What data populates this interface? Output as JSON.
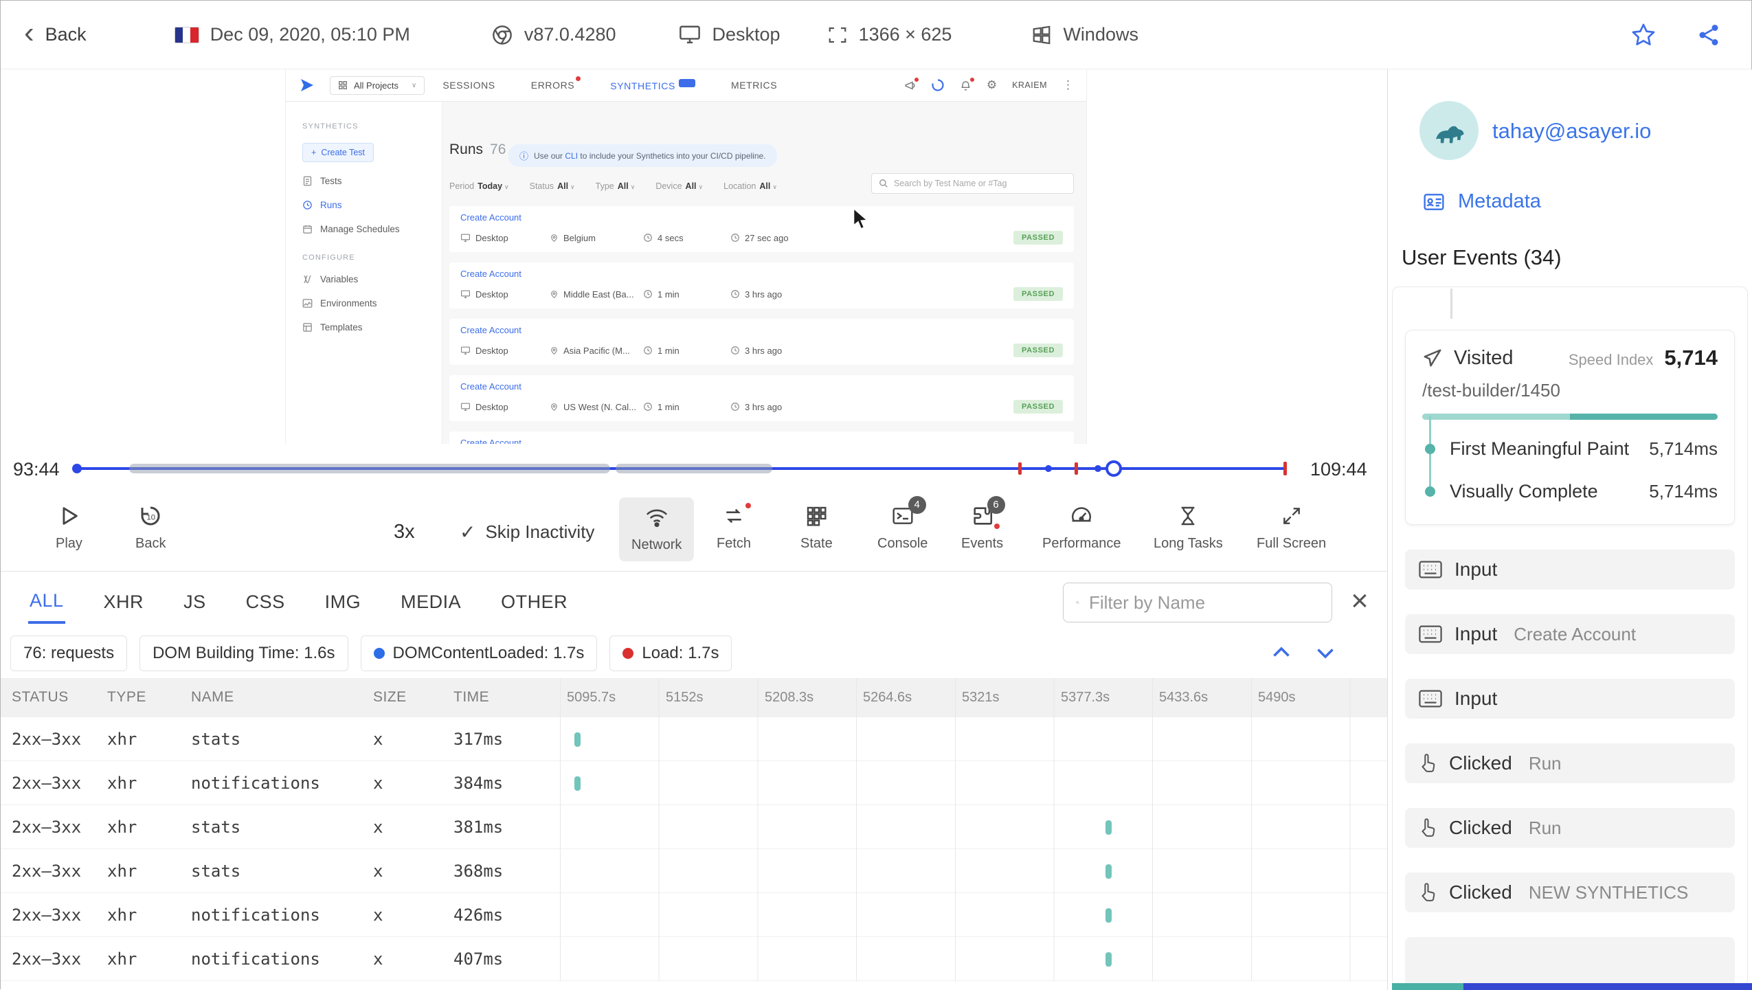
{
  "glyphs": {
    "back_chevron": "‹",
    "check": "✓",
    "close": "×",
    "caret": "∨",
    "kebab": "⋮",
    "info": "ⓘ",
    "fetch": "⇄",
    "gear": "⚙",
    "plus": "+"
  },
  "topbar": {
    "back_label": "Back",
    "datetime": "Dec 09, 2020, 05:10 PM",
    "browser_version": "v87.0.4280",
    "device": "Desktop",
    "resolution": "1366 × 625",
    "os": "Windows"
  },
  "app": {
    "nav": {
      "project": "All Projects",
      "tabs": [
        "SESSIONS",
        "ERRORS",
        "SYNTHETICS",
        "METRICS"
      ],
      "user": "KRAIEM"
    },
    "sidebar": {
      "section_synthetics": "SYNTHETICS",
      "create_test": "Create Test",
      "tests": "Tests",
      "runs": "Runs",
      "manage_schedules": "Manage Schedules",
      "section_configure": "CONFIGURE",
      "variables": "Variables",
      "environments": "Environments",
      "templates": "Templates"
    },
    "main": {
      "title": "Runs",
      "count": "76",
      "banner": {
        "pre": "Use our ",
        "link": "CLI",
        "post": " to include your Synthetics into your CI/CD pipeline."
      },
      "filters": [
        {
          "label": "Period",
          "value": "Today"
        },
        {
          "label": "Status",
          "value": "All"
        },
        {
          "label": "Type",
          "value": "All"
        },
        {
          "label": "Device",
          "value": "All"
        },
        {
          "label": "Location",
          "value": "All"
        }
      ],
      "search_placeholder": "Search by Test Name or #Tag",
      "runs": [
        {
          "name": "Create Account",
          "device": "Desktop",
          "location": "Belgium",
          "duration": "4 secs",
          "ago": "27 sec ago",
          "status": "PASSED"
        },
        {
          "name": "Create Account",
          "device": "Desktop",
          "location": "Middle East (Ba...",
          "duration": "1 min",
          "ago": "3 hrs ago",
          "status": "PASSED"
        },
        {
          "name": "Create Account",
          "device": "Desktop",
          "location": "Asia Pacific (M...",
          "duration": "1 min",
          "ago": "3 hrs ago",
          "status": "PASSED"
        },
        {
          "name": "Create Account",
          "device": "Desktop",
          "location": "US West (N. Cal...",
          "duration": "1 min",
          "ago": "3 hrs ago",
          "status": "PASSED"
        },
        {
          "name": "Create Account"
        }
      ]
    }
  },
  "timeline": {
    "start": "93:44",
    "end": "109:44"
  },
  "controls": {
    "play": "Play",
    "back": "Back",
    "back_amount": "10",
    "speed": "3x",
    "skip_inactivity": "Skip Inactivity",
    "network": "Network",
    "fetch": "Fetch",
    "state": "State",
    "console": "Console",
    "console_badge": "4",
    "events": "Events",
    "events_badge": "6",
    "performance": "Performance",
    "long_tasks": "Long Tasks",
    "full_screen": "Full Screen"
  },
  "network": {
    "tabs": [
      "ALL",
      "XHR",
      "JS",
      "CSS",
      "IMG",
      "MEDIA",
      "OTHER"
    ],
    "filter_placeholder": "Filter by Name",
    "summary": {
      "requests": "76: requests",
      "dom_building": "DOM Building Time: 1.6s",
      "dom_content_loaded": "DOMContentLoaded: 1.7s",
      "load": "Load: 1.7s"
    },
    "columns": [
      "STATUS",
      "TYPE",
      "NAME",
      "SIZE",
      "TIME"
    ],
    "time_ticks": [
      "5095.7s",
      "5152s",
      "5208.3s",
      "5264.6s",
      "5321s",
      "5377.3s",
      "5433.6s",
      "5490s"
    ],
    "rows": [
      {
        "status": "2xx–3xx",
        "type": "xhr",
        "name": "stats",
        "size": "x",
        "time": "317ms"
      },
      {
        "status": "2xx–3xx",
        "type": "xhr",
        "name": "notifications",
        "size": "x",
        "time": "384ms"
      },
      {
        "status": "2xx–3xx",
        "type": "xhr",
        "name": "stats",
        "size": "x",
        "time": "381ms"
      },
      {
        "status": "2xx–3xx",
        "type": "xhr",
        "name": "stats",
        "size": "x",
        "time": "368ms"
      },
      {
        "status": "2xx–3xx",
        "type": "xhr",
        "name": "notifications",
        "size": "x",
        "time": "426ms"
      },
      {
        "status": "2xx–3xx",
        "type": "xhr",
        "name": "notifications",
        "size": "x",
        "time": "407ms"
      }
    ]
  },
  "user_panel": {
    "email": "tahay@asayer.io",
    "metadata_label": "Metadata",
    "events_title": "User Events (34)",
    "visited": {
      "label": "Visited",
      "speed_index_label": "Speed Index",
      "speed_index_value": "5,714",
      "url": "/test-builder/1450",
      "metrics": [
        {
          "label": "First Meaningful Paint",
          "value": "5,714ms"
        },
        {
          "label": "Visually Complete",
          "value": "5,714ms"
        }
      ]
    },
    "events": [
      {
        "label": "Input",
        "value": ""
      },
      {
        "label": "Input",
        "value": "Create Account"
      },
      {
        "label": "Input",
        "value": ""
      },
      {
        "label": "Clicked",
        "value": "Run"
      },
      {
        "label": "Clicked",
        "value": "Run"
      },
      {
        "label": "Clicked",
        "value": "NEW SYNTHETICS"
      }
    ]
  }
}
